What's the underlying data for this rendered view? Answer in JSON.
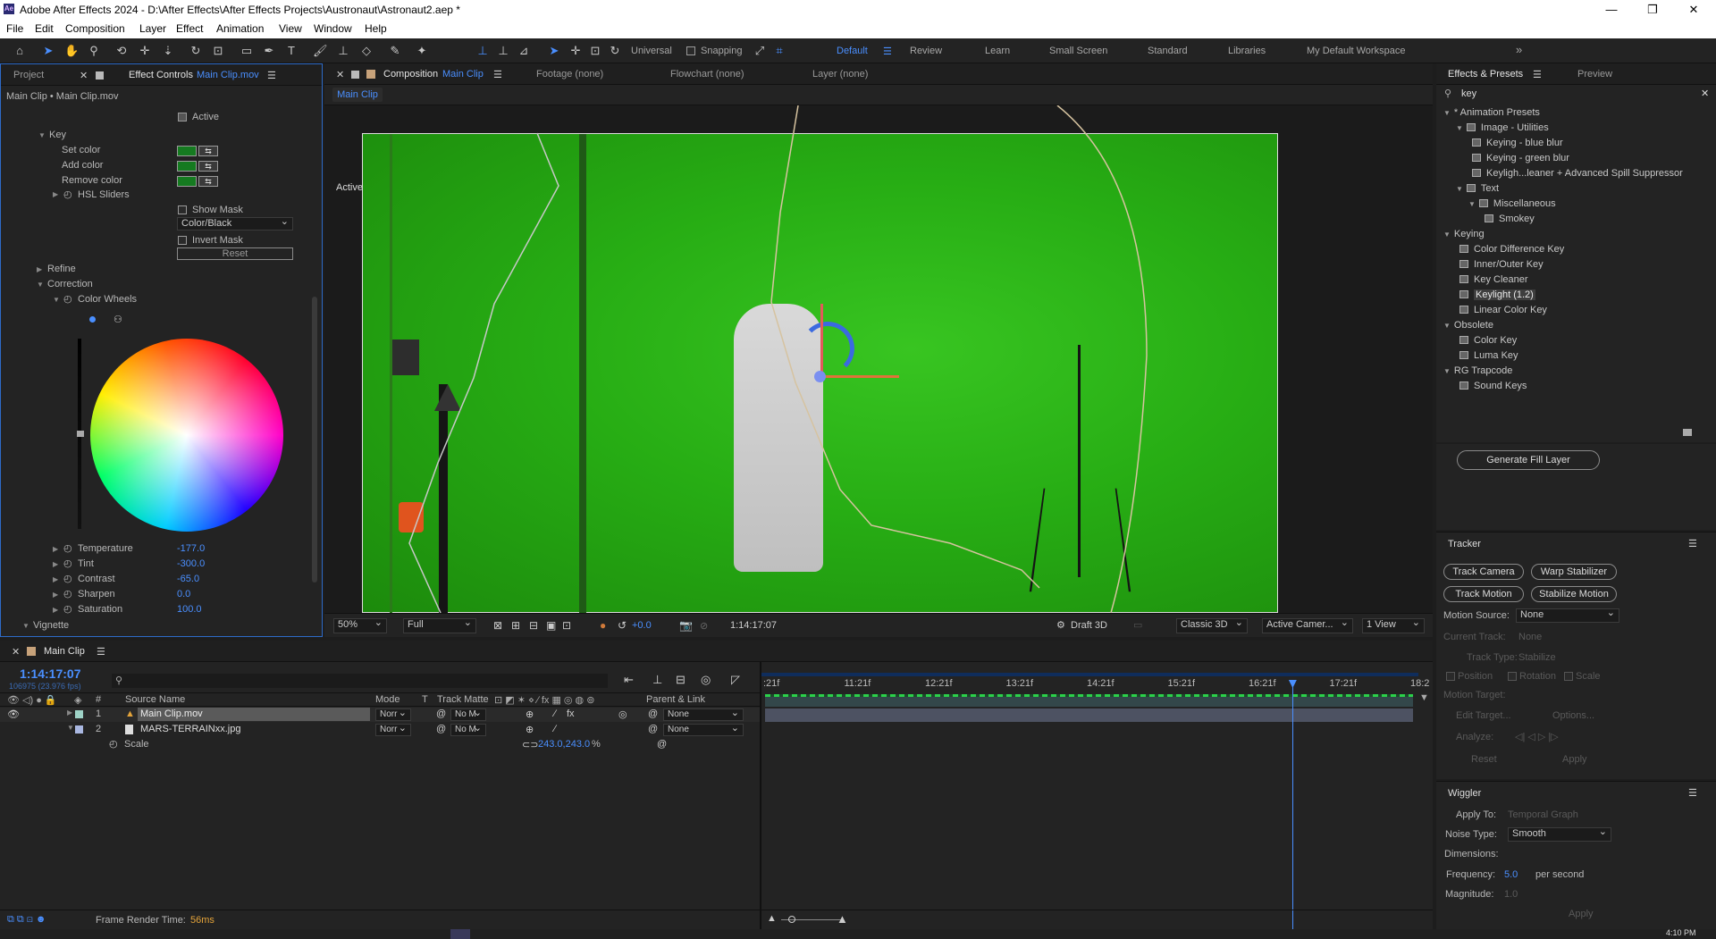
{
  "window": {
    "title": "Adobe After Effects 2024 - D:\\After Effects\\After Effects Projects\\Austronaut\\Astronaut2.aep *",
    "app_icon": "Ae",
    "minimize": "—",
    "restore": "❐",
    "close": "✕"
  },
  "menu": [
    "File",
    "Edit",
    "Composition",
    "Layer",
    "Effect",
    "Animation",
    "View",
    "Window",
    "Help"
  ],
  "toolbar": {
    "universal": "Universal",
    "snapping": "Snapping",
    "workspaces": [
      "Default",
      "Review",
      "Learn",
      "Small Screen",
      "Standard",
      "Libraries",
      "My Default Workspace"
    ],
    "active_workspace": "Default",
    "more": "»"
  },
  "left_panel": {
    "tab_project": "Project",
    "tab_effect_controls": "Effect Controls",
    "tab_effect_controls_target": "Main Clip.mov",
    "breadcrumb": "Main Clip • Main Clip.mov",
    "active_label": "Active",
    "key_label": "Key",
    "set_color": "Set color",
    "add_color": "Add color",
    "remove_color": "Remove color",
    "hsl_sliders": "HSL Sliders",
    "show_mask": "Show Mask",
    "mask_mode": "Color/Black",
    "invert_mask": "Invert Mask",
    "reset": "Reset",
    "refine": "Refine",
    "correction": "Correction",
    "color_wheels": "Color Wheels",
    "params": [
      {
        "name": "Temperature",
        "value": "-177.0"
      },
      {
        "name": "Tint",
        "value": "-300.0"
      },
      {
        "name": "Contrast",
        "value": "-65.0"
      },
      {
        "name": "Sharpen",
        "value": "0.0"
      },
      {
        "name": "Saturation",
        "value": "100.0"
      }
    ],
    "vignette": "Vignette",
    "key_swatch_color": "#157a20"
  },
  "comp_panel": {
    "tab_composition": "Composition",
    "tab_composition_target": "Main Clip",
    "tab_footage": "Footage (none)",
    "tab_flowchart": "Flowchart (none)",
    "tab_layer": "Layer (none)",
    "breadcrumb_chip": "Main Clip",
    "camera_label": "Active Camera (Default)",
    "zoom": "50%",
    "resolution": "Full",
    "exposure": "+0.0",
    "timecode": "1:14:17:07",
    "draft3d": "Draft 3D",
    "renderer": "Classic 3D",
    "camera": "Active Camer...",
    "views": "1 View",
    "screen_color": "#27ad14"
  },
  "right_panel": {
    "tab_effects": "Effects & Presets",
    "tab_preview": "Preview",
    "search_value": "key",
    "tree": [
      {
        "label": "* Animation Presets",
        "level": 0,
        "kind": "group"
      },
      {
        "label": "Image - Utilities",
        "level": 1,
        "kind": "folder"
      },
      {
        "label": "Keying - blue blur",
        "level": 2,
        "kind": "preset"
      },
      {
        "label": "Keying - green blur",
        "level": 2,
        "kind": "preset"
      },
      {
        "label": "Keyligh...leaner + Advanced Spill Suppressor",
        "level": 2,
        "kind": "preset"
      },
      {
        "label": "Text",
        "level": 1,
        "kind": "folder"
      },
      {
        "label": "Miscellaneous",
        "level": 2,
        "kind": "folder"
      },
      {
        "label": "Smokey",
        "level": 3,
        "kind": "preset"
      },
      {
        "label": "Keying",
        "level": 0,
        "kind": "group"
      },
      {
        "label": "Color Difference Key",
        "level": 1,
        "kind": "effect"
      },
      {
        "label": "Inner/Outer Key",
        "level": 1,
        "kind": "effect"
      },
      {
        "label": "Key Cleaner",
        "level": 1,
        "kind": "effect"
      },
      {
        "label": "Keylight (1.2)",
        "level": 1,
        "kind": "effect",
        "selected": true
      },
      {
        "label": "Linear Color Key",
        "level": 1,
        "kind": "effect"
      },
      {
        "label": "Obsolete",
        "level": 0,
        "kind": "group"
      },
      {
        "label": "Color Key",
        "level": 1,
        "kind": "effect"
      },
      {
        "label": "Luma Key",
        "level": 1,
        "kind": "effect"
      },
      {
        "label": "RG Trapcode",
        "level": 0,
        "kind": "group"
      },
      {
        "label": "Sound Keys",
        "level": 1,
        "kind": "effect"
      }
    ],
    "generate_fill": "Generate Fill Layer",
    "tracker": {
      "title": "Tracker",
      "track_camera": "Track Camera",
      "warp_stabilizer": "Warp Stabilizer",
      "track_motion": "Track Motion",
      "stabilize_motion": "Stabilize Motion",
      "motion_source_label": "Motion Source:",
      "motion_source": "None",
      "current_track_label": "Current Track:",
      "current_track": "None",
      "track_type_label": "Track Type:",
      "track_type": "Stabilize",
      "position": "Position",
      "rotation": "Rotation",
      "scale": "Scale",
      "motion_target": "Motion Target:",
      "edit_target": "Edit Target...",
      "options": "Options...",
      "analyze": "Analyze:",
      "reset": "Reset",
      "apply": "Apply"
    },
    "wiggler": {
      "title": "Wiggler",
      "apply_to_label": "Apply To:",
      "apply_to": "Temporal Graph",
      "noise_type_label": "Noise Type:",
      "noise_type": "Smooth",
      "dimensions_label": "Dimensions:",
      "frequency_label": "Frequency:",
      "frequency": "5.0",
      "per_second": "per second",
      "magnitude_label": "Magnitude:",
      "magnitude": "1.0",
      "apply": "Apply"
    }
  },
  "timeline": {
    "tab": "Main Clip",
    "timecode": "1:14:17:07",
    "frames": "106975 (23.976 fps)",
    "columns": {
      "num": "#",
      "source": "Source Name",
      "mode": "Mode",
      "t": "T",
      "track_matte": "Track Matte",
      "parent": "Parent & Link"
    },
    "layers": [
      {
        "num": "1",
        "name": "Main Clip.mov",
        "mode": "Norr",
        "matte": "No M",
        "parent": "None",
        "label_color": "#9fd3c7"
      },
      {
        "num": "2",
        "name": "MARS-TERRAINxx.jpg",
        "mode": "Norr",
        "matte": "No M",
        "parent": "None",
        "label_color": "#a9b7e0"
      }
    ],
    "property": {
      "name": "Scale",
      "value": "243.0,243.0",
      "unit": "%"
    },
    "ruler": [
      ":21f",
      "11:21f",
      "12:21f",
      "13:21f",
      "14:21f",
      "15:21f",
      "16:21f",
      "17:21f",
      "18:2"
    ],
    "playhead_fraction": 0.808,
    "frame_render_label": "Frame Render Time:",
    "frame_render_value": "56ms"
  },
  "taskbar": {
    "clock": "4:10 PM"
  }
}
